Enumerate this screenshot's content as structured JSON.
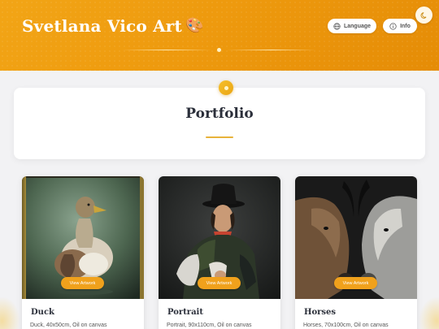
{
  "header": {
    "title": "Svetlana Vico Art",
    "title_icon": "palette-icon",
    "language_label": "Language",
    "info_label": "Info",
    "theme_toggle_icon": "moon-icon"
  },
  "section": {
    "title": "Portfolio"
  },
  "artworks": [
    {
      "title": "Duck",
      "description": "Duck, 40x50cm, Oil on canvas",
      "button_label": "View Artwork"
    },
    {
      "title": "Portrait",
      "description": "Portrait, 90x110cm, Oil on canvas",
      "button_label": "View Artwork"
    },
    {
      "title": "Horses",
      "description": "Horses, 70x100cm, Oil on canvas",
      "button_label": "View Artwork"
    }
  ],
  "colors": {
    "accent": "#f0a11c",
    "header_gradient_start": "#f2a516",
    "header_gradient_end": "#e58c06",
    "heading_text": "#2b2f3a"
  }
}
